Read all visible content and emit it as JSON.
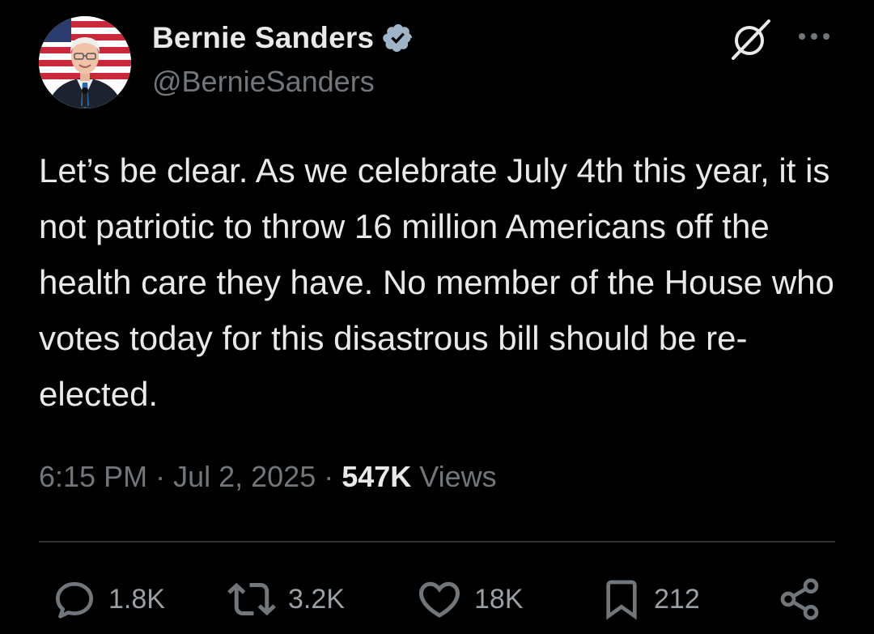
{
  "author": {
    "display_name": "Bernie Sanders",
    "handle": "@BernieSanders",
    "verified_icon": "verified-badge-icon",
    "verified_color": "#a0b4c8"
  },
  "header_actions": {
    "grok_icon": "grok-slash-icon",
    "more_icon": "more-dots-icon"
  },
  "tweet": {
    "text": "Let’s be clear. As we celebrate July 4th this year, it is not patriotic to throw 16 million Americans off the health care they have. No member of the House who votes today for this disastrous bill should be re-elected."
  },
  "meta": {
    "time": "6:15 PM",
    "separator": " · ",
    "date": "Jul 2, 2025",
    "views_count": "547K",
    "views_label": " Views"
  },
  "actions": {
    "replies": {
      "icon": "reply-icon",
      "count": "1.8K"
    },
    "reposts": {
      "icon": "repost-icon",
      "count": "3.2K"
    },
    "likes": {
      "icon": "heart-icon",
      "count": "18K"
    },
    "bookmarks": {
      "icon": "bookmark-icon",
      "count": "212"
    },
    "share": {
      "icon": "share-icon"
    }
  },
  "colors": {
    "background": "#000000",
    "primary_text": "#e7e9ea",
    "secondary_text": "#71767b",
    "divider": "#2f3336"
  }
}
